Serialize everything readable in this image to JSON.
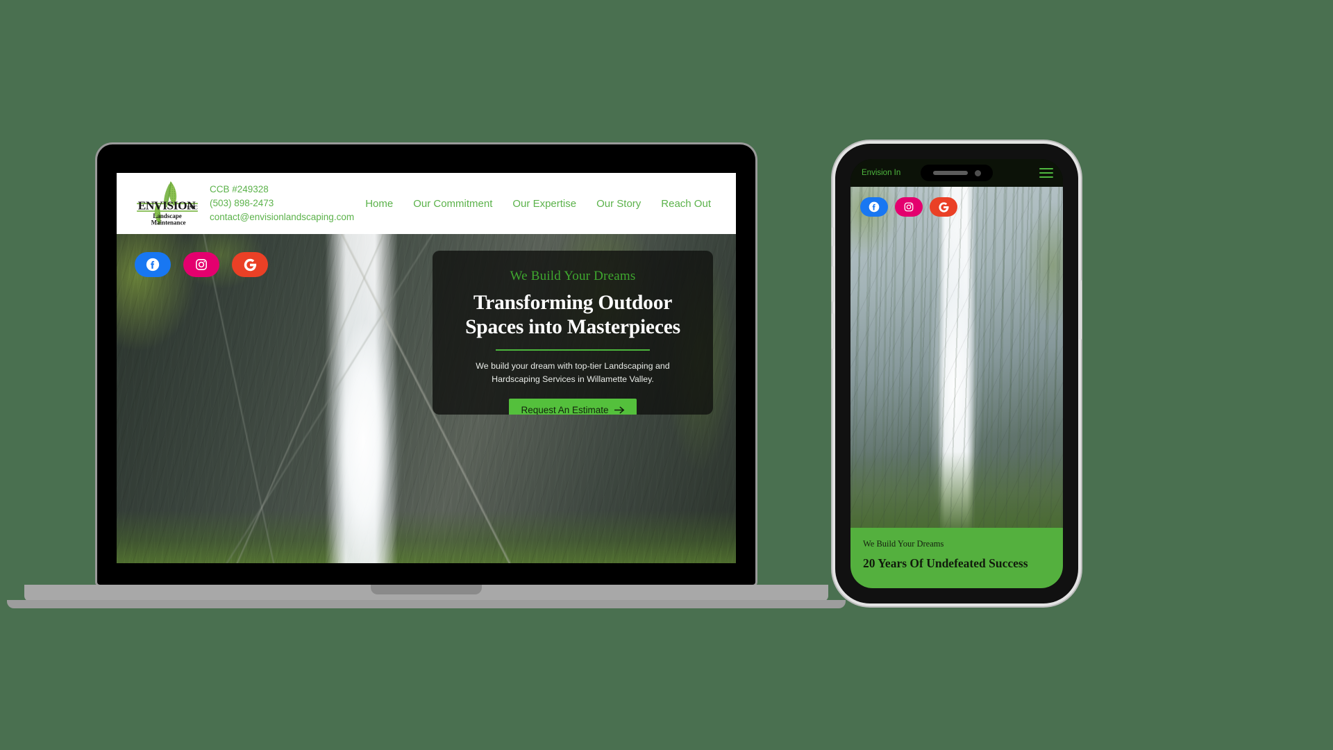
{
  "page": {
    "background_color": "#4a7050",
    "accent_green": "#5bb24a",
    "cta_green": "#54c03c",
    "panel_green": "#54b03e"
  },
  "laptop": {
    "header": {
      "logo": {
        "icon": "leaf-logo-icon",
        "wordmark": "ENVISION",
        "suffix": "INC",
        "tagline_line1": "Landscape",
        "tagline_line2": "Maintenance"
      },
      "contact": {
        "license": "CCB #249328",
        "phone": "(503) 898-2473",
        "email": "contact@envisionlandscaping.com"
      },
      "nav": [
        {
          "label": "Home",
          "active": true
        },
        {
          "label": "Our Commitment",
          "active": false
        },
        {
          "label": "Our Expertise",
          "active": false
        },
        {
          "label": "Our Story",
          "active": false
        },
        {
          "label": "Reach Out",
          "active": false
        }
      ]
    },
    "social": [
      {
        "name": "facebook",
        "icon": "facebook-icon",
        "color": "#1877f2"
      },
      {
        "name": "instagram",
        "icon": "instagram-icon",
        "color": "#e4006e"
      },
      {
        "name": "google",
        "icon": "google-icon",
        "color": "#ea4026"
      }
    ],
    "hero": {
      "eyebrow": "We Build Your Dreams",
      "title": "Transforming Outdoor Spaces into Masterpieces",
      "subtitle": "We build your dream with top-tier Landscaping and Hardscaping Services in Willamette Valley.",
      "cta_label": "Request An Estimate",
      "cta_icon": "arrow-right-icon"
    }
  },
  "phone": {
    "topbar": {
      "brand": "Envision In",
      "menu_icon": "hamburger-menu-icon"
    },
    "social": [
      {
        "name": "facebook",
        "icon": "facebook-icon",
        "color": "#1877f2"
      },
      {
        "name": "instagram",
        "icon": "instagram-icon",
        "color": "#e4006e"
      },
      {
        "name": "google",
        "icon": "google-icon",
        "color": "#ea4026"
      }
    ],
    "panel": {
      "eyebrow": "We Build Your Dreams",
      "title": "20 Years Of Undefeated Success"
    }
  }
}
